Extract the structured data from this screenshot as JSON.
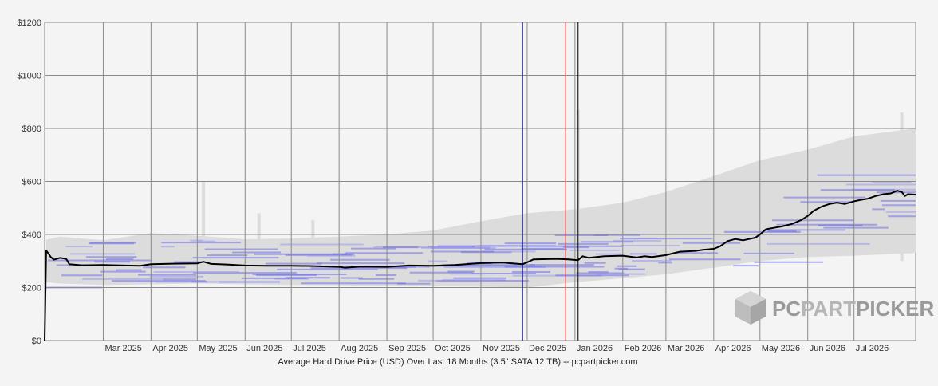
{
  "chart_data": {
    "type": "line",
    "caption": "Average Hard Drive Price (USD) Over Last 18 Months (3.5\" SATA 12 TB) -- pcpartpicker.com",
    "ylim": [
      0,
      1200
    ],
    "y_ticks": [
      {
        "value": 0,
        "label": "$0"
      },
      {
        "value": 200,
        "label": "$200"
      },
      {
        "value": 400,
        "label": "$400"
      },
      {
        "value": 600,
        "label": "$600"
      },
      {
        "value": 800,
        "label": "$800"
      },
      {
        "value": 1000,
        "label": "$1000"
      },
      {
        "value": 1200,
        "label": "$1200"
      }
    ],
    "x_domain": [
      "2025-01-22",
      "2026-08-10"
    ],
    "x_ticks": [
      {
        "date": "2025-03-01",
        "label": "Mar 2025"
      },
      {
        "date": "2025-04-01",
        "label": "Apr 2025"
      },
      {
        "date": "2025-05-01",
        "label": "May 2025"
      },
      {
        "date": "2025-06-01",
        "label": "Jun 2025"
      },
      {
        "date": "2025-07-01",
        "label": "Jul 2025"
      },
      {
        "date": "2025-08-01",
        "label": "Aug 2025"
      },
      {
        "date": "2025-09-01",
        "label": "Sep 2025"
      },
      {
        "date": "2025-10-01",
        "label": "Oct 2025"
      },
      {
        "date": "2025-11-01",
        "label": "Nov 2025"
      },
      {
        "date": "2025-12-01",
        "label": "Dec 2025"
      },
      {
        "date": "2026-01-01",
        "label": "Jan 2026"
      },
      {
        "date": "2026-02-01",
        "label": "Feb 2026"
      },
      {
        "date": "2026-03-01",
        "label": "Mar 2026"
      },
      {
        "date": "2026-04-01",
        "label": "Apr 2026"
      },
      {
        "date": "2026-05-01",
        "label": "May 2026"
      },
      {
        "date": "2026-06-01",
        "label": "Jun 2026"
      },
      {
        "date": "2026-07-01",
        "label": "Jul 2026"
      }
    ],
    "grid": true,
    "markers": [
      {
        "date": "2025-11-28",
        "color": "#1a1aa0"
      },
      {
        "date": "2025-12-26",
        "color": "#cc1111"
      },
      {
        "date": "2026-01-03",
        "color": "#222222"
      }
    ],
    "series": [
      {
        "role": "average",
        "color": "#000000",
        "points": [
          [
            "2025-01-22",
            0
          ],
          [
            "2025-01-23",
            340
          ],
          [
            "2025-01-26",
            315
          ],
          [
            "2025-01-28",
            305
          ],
          [
            "2025-02-01",
            312
          ],
          [
            "2025-02-05",
            308
          ],
          [
            "2025-02-07",
            288
          ],
          [
            "2025-02-15",
            284
          ],
          [
            "2025-03-01",
            285
          ],
          [
            "2025-03-15",
            283
          ],
          [
            "2025-03-25",
            282
          ],
          [
            "2025-04-01",
            288
          ],
          [
            "2025-04-15",
            290
          ],
          [
            "2025-05-01",
            291
          ],
          [
            "2025-05-05",
            297
          ],
          [
            "2025-05-10",
            289
          ],
          [
            "2025-05-20",
            287
          ],
          [
            "2025-06-01",
            283
          ],
          [
            "2025-06-15",
            282
          ],
          [
            "2025-07-01",
            282
          ],
          [
            "2025-07-15",
            281
          ],
          [
            "2025-08-01",
            278
          ],
          [
            "2025-08-05",
            275
          ],
          [
            "2025-08-15",
            279
          ],
          [
            "2025-09-01",
            278
          ],
          [
            "2025-09-15",
            283
          ],
          [
            "2025-10-01",
            282
          ],
          [
            "2025-10-15",
            285
          ],
          [
            "2025-11-01",
            292
          ],
          [
            "2025-11-15",
            294
          ],
          [
            "2025-11-28",
            288
          ],
          [
            "2025-12-01",
            295
          ],
          [
            "2025-12-05",
            306
          ],
          [
            "2025-12-20",
            308
          ],
          [
            "2025-12-28",
            306
          ],
          [
            "2026-01-03",
            303
          ],
          [
            "2026-01-06",
            318
          ],
          [
            "2026-01-10",
            312
          ],
          [
            "2026-01-20",
            318
          ],
          [
            "2026-02-01",
            320
          ],
          [
            "2026-02-10",
            313
          ],
          [
            "2026-02-15",
            318
          ],
          [
            "2026-02-20",
            315
          ],
          [
            "2026-03-01",
            322
          ],
          [
            "2026-03-10",
            335
          ],
          [
            "2026-03-20",
            338
          ],
          [
            "2026-03-25",
            342
          ],
          [
            "2026-04-01",
            346
          ],
          [
            "2026-04-05",
            355
          ],
          [
            "2026-04-10",
            375
          ],
          [
            "2026-04-15",
            383
          ],
          [
            "2026-04-20",
            378
          ],
          [
            "2026-04-28",
            388
          ],
          [
            "2026-05-01",
            400
          ],
          [
            "2026-05-05",
            420
          ],
          [
            "2026-05-10",
            425
          ],
          [
            "2026-05-15",
            430
          ],
          [
            "2026-05-22",
            440
          ],
          [
            "2026-05-28",
            455
          ],
          [
            "2026-06-01",
            470
          ],
          [
            "2026-06-05",
            490
          ],
          [
            "2026-06-10",
            505
          ],
          [
            "2026-06-15",
            515
          ],
          [
            "2026-06-20",
            520
          ],
          [
            "2026-06-25",
            515
          ],
          [
            "2026-07-01",
            525
          ],
          [
            "2026-07-05",
            530
          ],
          [
            "2026-07-10",
            535
          ],
          [
            "2026-07-15",
            545
          ],
          [
            "2026-07-20",
            552
          ],
          [
            "2026-07-25",
            555
          ],
          [
            "2026-07-29",
            565
          ],
          [
            "2026-08-01",
            560
          ],
          [
            "2026-08-03",
            545
          ],
          [
            "2026-08-05",
            552
          ],
          [
            "2026-08-10",
            550
          ]
        ]
      }
    ],
    "range_band": {
      "color": "#dcdcdc",
      "points": [
        [
          "2025-01-23",
          220,
          380
        ],
        [
          "2025-02-01",
          215,
          392
        ],
        [
          "2025-03-01",
          210,
          378
        ],
        [
          "2025-04-01",
          212,
          405
        ],
        [
          "2025-05-01",
          215,
          395
        ],
        [
          "2025-06-01",
          212,
          382
        ],
        [
          "2025-07-01",
          210,
          385
        ],
        [
          "2025-08-01",
          208,
          392
        ],
        [
          "2025-09-01",
          205,
          400
        ],
        [
          "2025-10-01",
          205,
          415
        ],
        [
          "2025-11-01",
          203,
          450
        ],
        [
          "2025-12-01",
          200,
          480
        ],
        [
          "2026-01-01",
          220,
          495
        ],
        [
          "2026-02-01",
          235,
          520
        ],
        [
          "2026-03-01",
          250,
          560
        ],
        [
          "2026-04-01",
          275,
          620
        ],
        [
          "2026-05-01",
          300,
          680
        ],
        [
          "2026-06-01",
          315,
          720
        ],
        [
          "2026-07-01",
          320,
          770
        ],
        [
          "2026-08-10",
          330,
          800
        ]
      ]
    },
    "spikes": [
      [
        "2025-05-05",
        600
      ],
      [
        "2025-06-10",
        480
      ],
      [
        "2025-07-15",
        455
      ],
      [
        "2026-01-03",
        870
      ],
      [
        "2026-08-01",
        860
      ]
    ],
    "retailer_bands": [
      {
        "color": "#6e6ee6",
        "values": [
          215,
          230,
          245,
          260,
          275,
          290,
          300,
          315,
          330,
          345,
          360,
          375,
          390
        ]
      },
      {
        "color": "#9a9af0",
        "values": [
          220,
          250,
          270,
          295,
          320,
          340,
          385
        ]
      }
    ],
    "watermark": {
      "part1": "PC",
      "part2": "PART",
      "part3": "PICKER"
    }
  }
}
